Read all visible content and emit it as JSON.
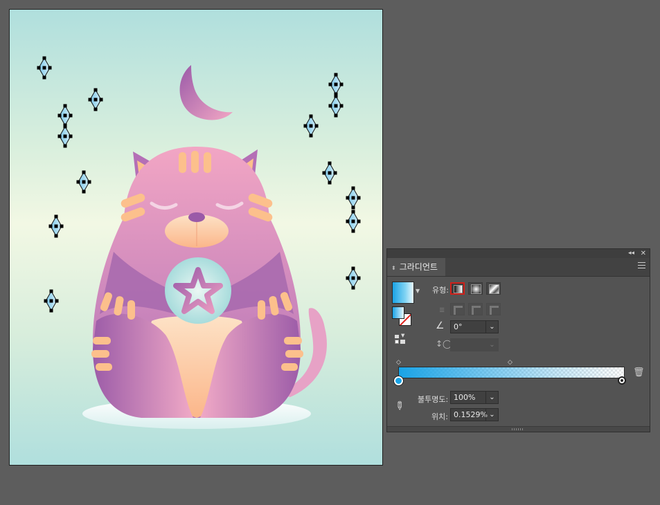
{
  "gradient_panel": {
    "title": "그라디언트",
    "type_label": "유형:",
    "angle_value": "0°",
    "opacity_label": "불투명도:",
    "opacity_value": "100%",
    "location_label": "위치:",
    "location_value": "0.1529%",
    "gradient_type_selected": "linear",
    "start_color": "#1aa3e6",
    "end_color": "#ffffff"
  },
  "icons": [
    "collapse-arrows-icon",
    "close-icon",
    "panel-menu-icon",
    "gradient-swatch-icon",
    "fill-stroke-icon",
    "linear-gradient-icon",
    "radial-gradient-icon",
    "freeform-gradient-icon",
    "stroke-within-icon",
    "stroke-along-icon",
    "stroke-across-icon",
    "angle-icon",
    "aspect-ratio-icon",
    "eyedropper-icon",
    "trash-icon",
    "reverse-gradient-icon"
  ],
  "colors": {
    "canvas_bg": "#5d5d5d",
    "panel_bg": "#535353",
    "artboard_top": "#b0dfdd",
    "artboard_mid": "#f2f8e4",
    "cat_pink": "#eaa0c2",
    "cat_purple": "#a062a8",
    "peach": "#fcc08c",
    "selection_blue": "#2aa9e0"
  }
}
